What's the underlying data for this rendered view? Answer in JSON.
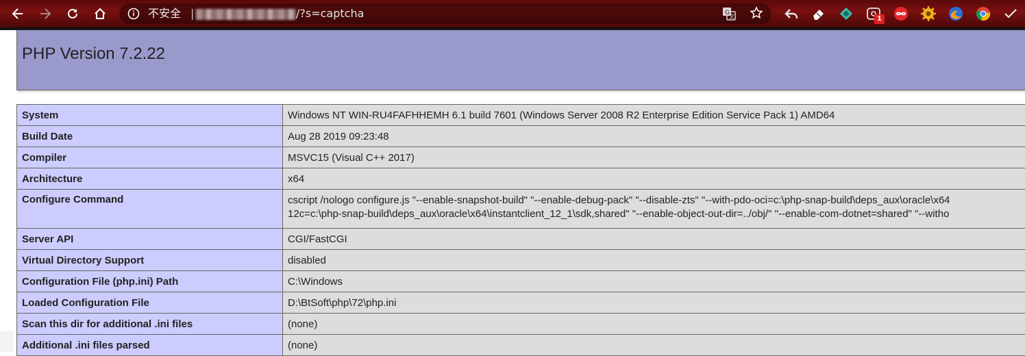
{
  "browser": {
    "security_label": "不安全",
    "separator": "|",
    "url_tail": "/?s=captcha",
    "extension_badge": "1",
    "icons": [
      "back-icon",
      "forward-icon",
      "reload-icon",
      "home-icon",
      "info-icon",
      "translate-icon",
      "star-icon",
      "reply-icon",
      "eraser-icon",
      "diamond-icon",
      "camera-icon",
      "infinity-icon",
      "gear-icon",
      "firefox-icon",
      "chrome-icon",
      "check-icon"
    ]
  },
  "page": {
    "title": "PHP Version 7.2.22"
  },
  "info_table": [
    {
      "name": "System",
      "value": "Windows NT WIN-RU4FAFHHEMH 6.1 build 7601 (Windows Server 2008 R2 Enterprise Edition Service Pack 1) AMD64"
    },
    {
      "name": "Build Date",
      "value": "Aug 28 2019 09:23:48"
    },
    {
      "name": "Compiler",
      "value": "MSVC15 (Visual C++ 2017)"
    },
    {
      "name": "Architecture",
      "value": "x64"
    },
    {
      "name": "Configure Command",
      "value_line1": "cscript /nologo configure.js \"--enable-snapshot-build\" \"--enable-debug-pack\" \"--disable-zts\" \"--with-pdo-oci=c:\\php-snap-build\\deps_aux\\oracle\\x64",
      "value_line2": "12c=c:\\php-snap-build\\deps_aux\\oracle\\x64\\instantclient_12_1\\sdk,shared\" \"--enable-object-out-dir=../obj/\" \"--enable-com-dotnet=shared\" \"--witho"
    },
    {
      "name": "Server API",
      "value": "CGI/FastCGI"
    },
    {
      "name": "Virtual Directory Support",
      "value": "disabled"
    },
    {
      "name": "Configuration File (php.ini) Path",
      "value": "C:\\Windows"
    },
    {
      "name": "Loaded Configuration File",
      "value": "D:\\BtSoft\\php\\72\\php.ini"
    },
    {
      "name": "Scan this dir for additional .ini files",
      "value": "(none)"
    },
    {
      "name": "Additional .ini files parsed",
      "value": "(none)"
    }
  ],
  "colors": {
    "header_bg": "#9999cc",
    "label_bg": "#ccccff",
    "value_bg": "#dddddd",
    "toolbar_bg": "#6a0e0e"
  }
}
